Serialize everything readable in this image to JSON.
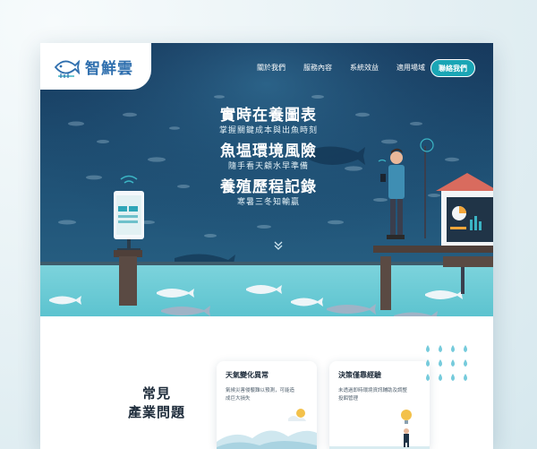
{
  "brand": {
    "name": "智鮮雲"
  },
  "nav": {
    "links": [
      "關於我們",
      "服務內容",
      "系統效益",
      "適用場域"
    ],
    "contact_label": "聯絡我們"
  },
  "hero": {
    "blocks": [
      {
        "title": "實時在養圖表",
        "subtitle": "掌握關鍵成本與出魚時刻"
      },
      {
        "title": "魚塭環境風險",
        "subtitle": "隨手看天顧水早準備"
      },
      {
        "title": "養殖歷程記錄",
        "subtitle": "寒暑三冬知輸贏"
      }
    ],
    "scroll_icon": "double-chevron-down-icon"
  },
  "issues": {
    "title_line1": "常見",
    "title_line2": "產業問題",
    "cards": [
      {
        "title": "天氣變化異常",
        "body": "氣候災害侵襲難以預測，可能造成巨大損失"
      },
      {
        "title": "決策僅靠經驗",
        "body": "未透過即時環境資訊輔助及調整投餌管理"
      }
    ]
  },
  "colors": {
    "accent": "#1aa5b5",
    "hero_dark": "#16385c",
    "water": "#6fcdd7",
    "brand_blue": "#2f6fae"
  }
}
